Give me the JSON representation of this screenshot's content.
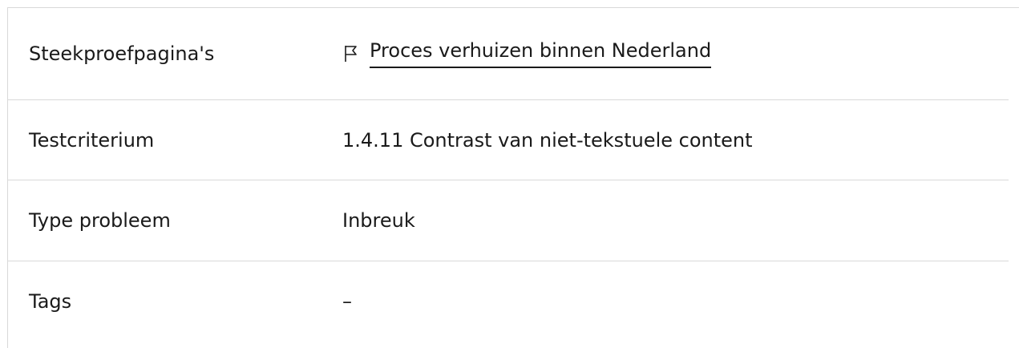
{
  "rows": [
    {
      "label": "Steekproefpagina's",
      "value": "Proces verhuizen binnen Nederland",
      "icon": "flag-icon"
    },
    {
      "label": "Testcriterium",
      "value": "1.4.11 Contrast van niet-tekstuele content"
    },
    {
      "label": "Type probleem",
      "value": "Inbreuk"
    },
    {
      "label": "Tags",
      "value": "–"
    }
  ],
  "colors": {
    "divider": "#d9d9d9",
    "text": "#1a1a1a"
  }
}
